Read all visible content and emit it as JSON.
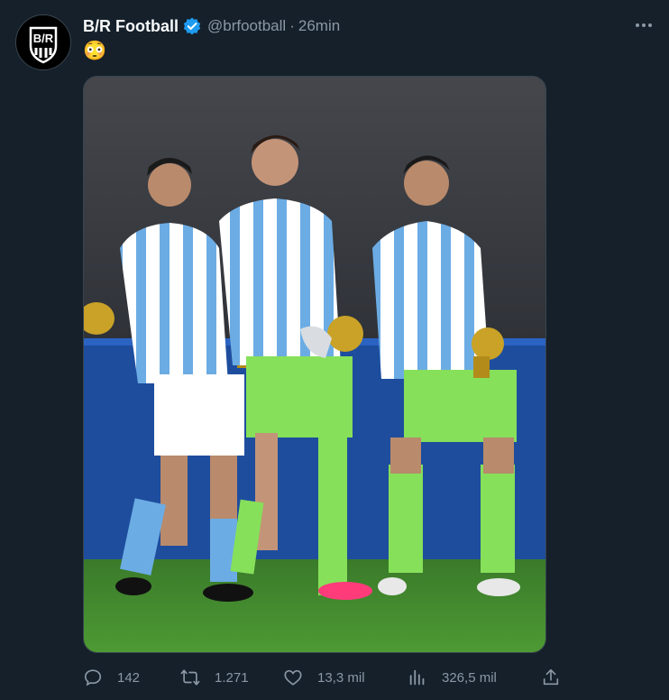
{
  "tweet": {
    "author_name": "B/R Football",
    "handle": "@brfootball",
    "separator": "·",
    "time": "26min",
    "text": "😳",
    "avatar_text": "B/R"
  },
  "actions": {
    "replies": "142",
    "retweets": "1.271",
    "likes": "13,3 mil",
    "views": "326,5 mil"
  },
  "colors": {
    "background": "#15202b",
    "secondary_text": "#8b98a5",
    "verified_blue": "#1d9bf0",
    "jersey_sky": "#6cace4",
    "keeper_green": "#86e05a"
  }
}
